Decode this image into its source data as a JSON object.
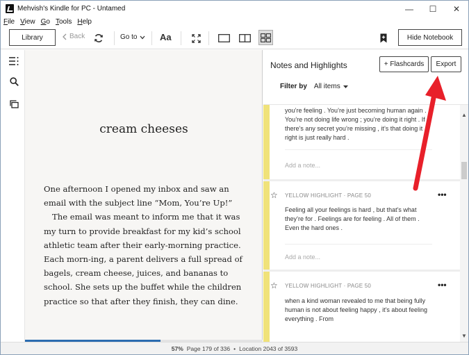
{
  "window": {
    "title": "Mehvish's Kindle for PC - Untamed",
    "minimize": "—",
    "maximize": "☐",
    "close": "✕"
  },
  "menu": {
    "file": "F",
    "file_rest": "ile",
    "view": "V",
    "view_rest": "iew",
    "go": "G",
    "go_rest": "o",
    "tools": "T",
    "tools_rest": "ools",
    "help": "H",
    "help_rest": "elp"
  },
  "toolbar": {
    "library": "Library",
    "back": "Back",
    "goto": "Go to",
    "font": "Aa",
    "hide_notebook": "Hide Notebook"
  },
  "reader": {
    "chapter_title": "cream cheeses",
    "paragraphs": [
      "One afternoon I opened my inbox and saw an email with the subject line “Mom, You’re Up!”",
      "The email was meant to inform me that it was my turn to provide breakfast for my kid’s school athletic team after their early-morning practice. Each morn-ing, a parent delivers a full spread of bagels, cream cheese, juices, and bananas to school. She sets up the buffet while the children practice so that after they finish, they can dine."
    ],
    "progress_fraction": 0.57
  },
  "notebook": {
    "title": "Notes and Highlights",
    "flashcards": "+ Flashcards",
    "export": "Export",
    "filter_label": "Filter by",
    "filter_value": "All items",
    "cards": [
      {
        "meta": "",
        "text": "you’re feeling . You’re just becoming human again . You’re not doing life wrong ; you’re doing it right . If there’s any secret you’re missing , it’s that doing it right is just really hard .",
        "note_placeholder": "Add a note..."
      },
      {
        "meta": "YELLOW HIGHLIGHT · PAGE 50",
        "text": "Feeling all your feelings is hard , but that’s what they’re for . Feelings are for feeling . All of them . Even the hard ones .",
        "note_placeholder": "Add a note..."
      },
      {
        "meta": "YELLOW HIGHLIGHT · PAGE 50",
        "text": "when a kind woman revealed to me that being fully human is not about feeling happy , it’s about feeling everything . From",
        "note_placeholder": ""
      }
    ]
  },
  "status": {
    "percent": "57%",
    "page": "Page 179 of 336",
    "dot": "•",
    "location": "Location 2043 of 3593"
  },
  "colors": {
    "highlight": "#f0e27a",
    "progress": "#2b6cb0",
    "annotation_arrow": "#e8202a"
  }
}
